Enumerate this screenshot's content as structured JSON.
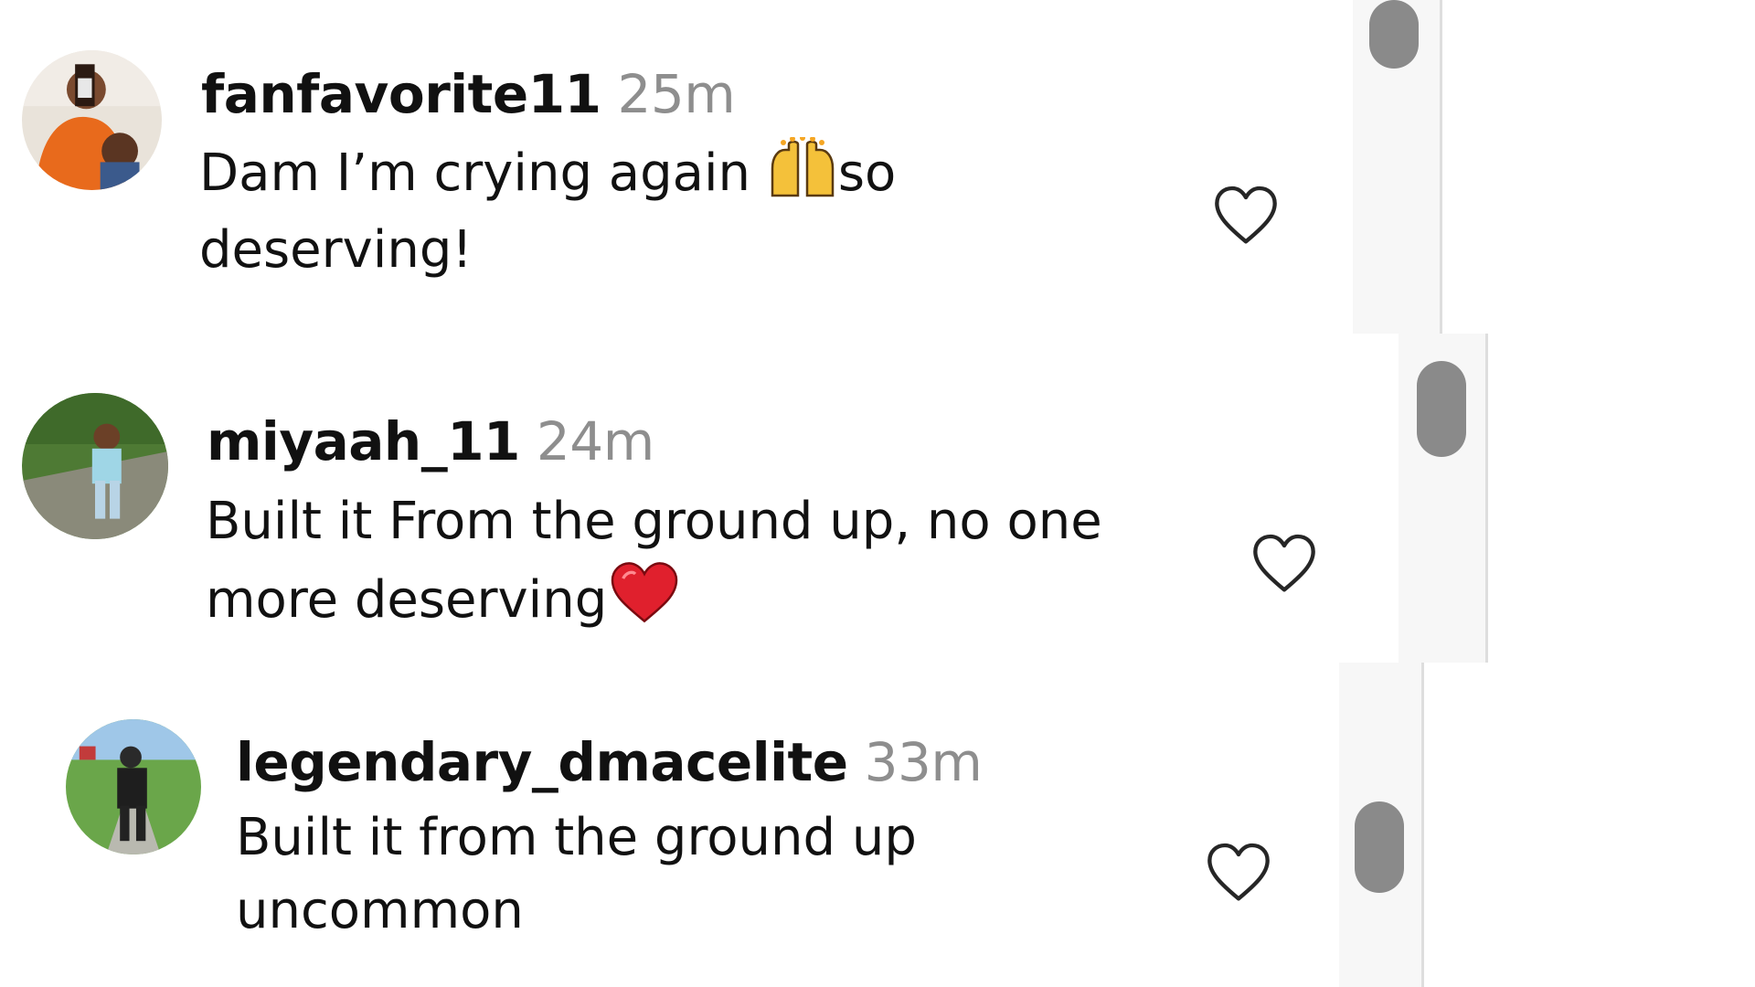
{
  "comments": [
    {
      "username": "fanfavorite11",
      "time": "25m",
      "line1": "Dam I’m crying again",
      "line1_tail": "so",
      "line2": "deserving!",
      "emoji": "raising-hands-emoji",
      "avatar": "avatar-fanfavorite11"
    },
    {
      "username": "miyaah_11",
      "time": "24m",
      "line1": "Built it From the ground up, no one",
      "line2": "more deserving",
      "emoji": "red-heart-emoji",
      "avatar": "avatar-miyaah_11"
    },
    {
      "username": "legendary_dmacelite",
      "time": "33m",
      "line1": "Built it from the ground up",
      "line2": "uncommon",
      "avatar": "avatar-legendary_dmacelite"
    }
  ],
  "icons": {
    "like": "heart-outline-icon"
  },
  "colors": {
    "text": "#111111",
    "meta": "#8e8e8e",
    "icon": "#262626",
    "scroll_thumb": "#8a8a8a",
    "heart_emoji": "#e0202d"
  }
}
